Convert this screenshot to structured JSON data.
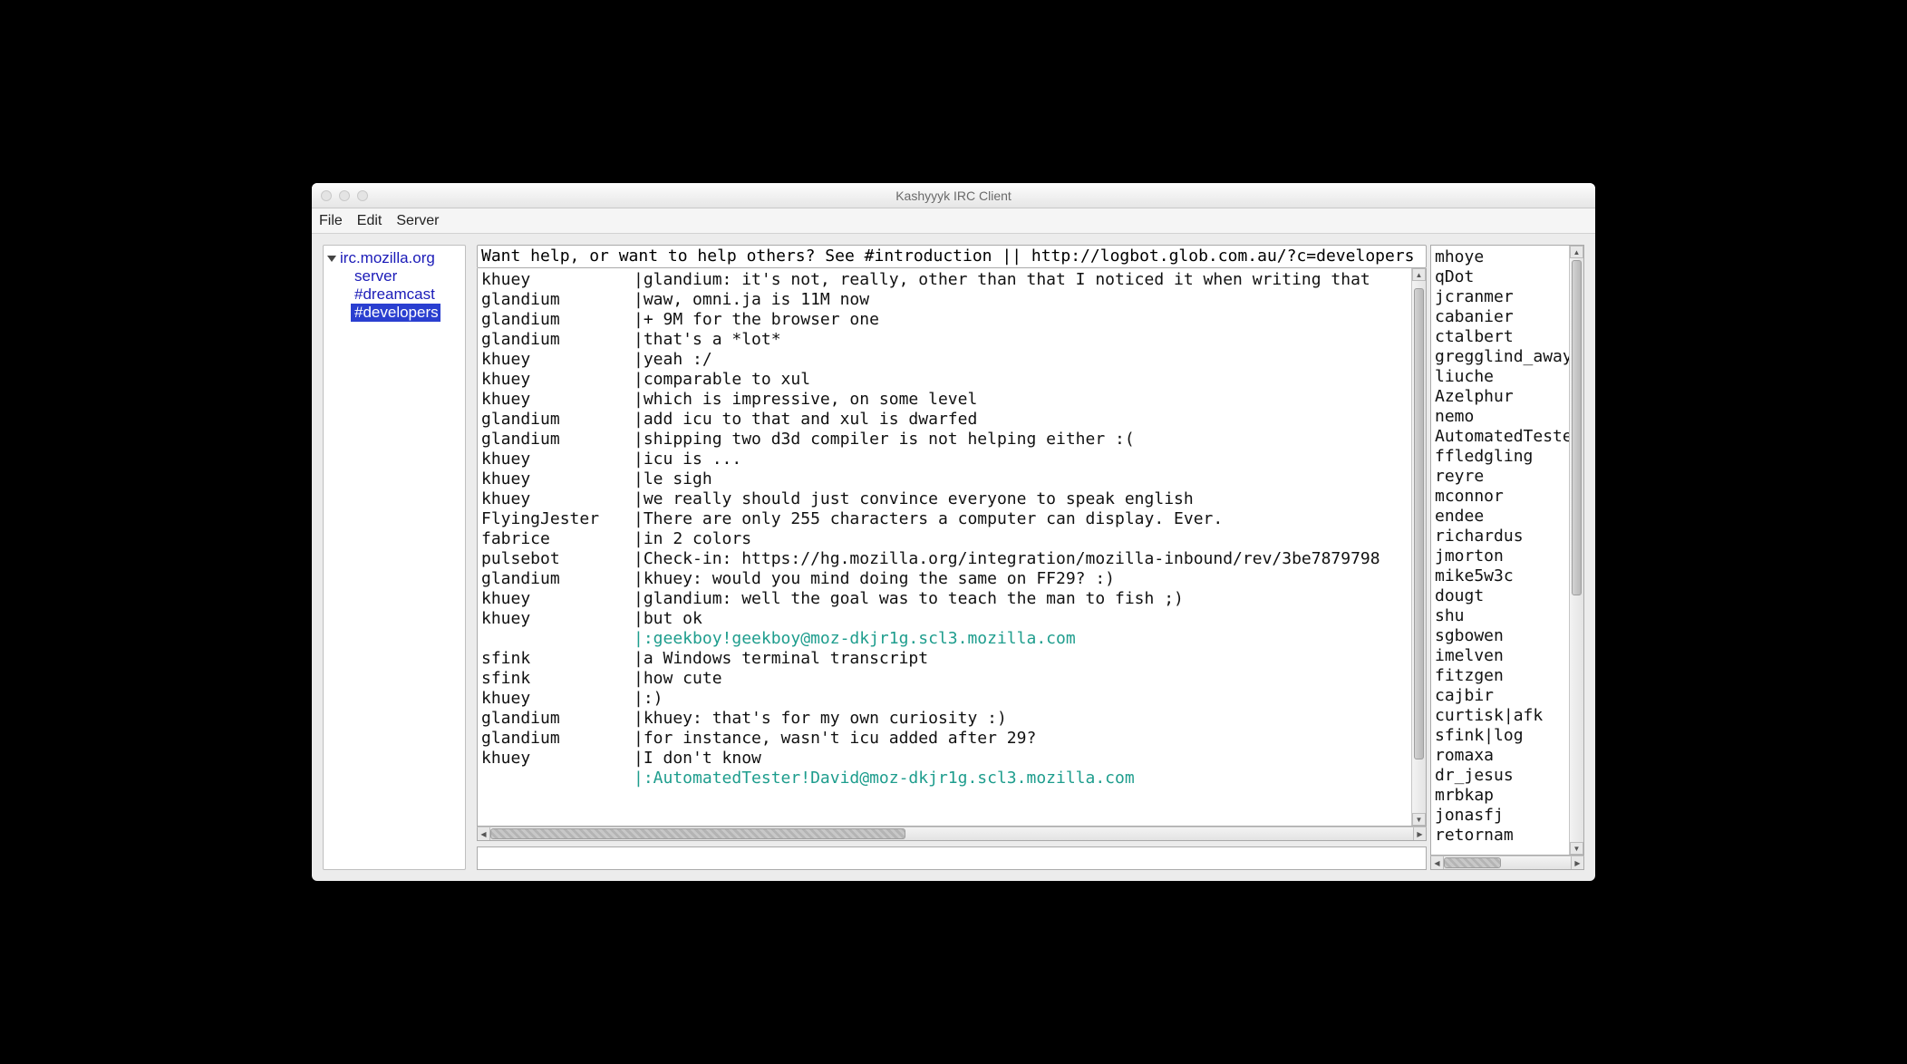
{
  "window": {
    "title": "Kashyyyk IRC Client"
  },
  "menubar": {
    "file": "File",
    "edit": "Edit",
    "server": "Server"
  },
  "sidebar": {
    "server": "irc.mozilla.org",
    "channels": [
      {
        "label": "server",
        "selected": false
      },
      {
        "label": "#dreamcast",
        "selected": false
      },
      {
        "label": "#developers",
        "selected": true
      }
    ]
  },
  "topic": "Want help, or want to help others? See #introduction || http://logbot.glob.com.au/?c=developers || Updated XCode? Acce",
  "chat": [
    {
      "nick": "khuey",
      "text": "|glandium: it's not, really, other than that I noticed it when writing that"
    },
    {
      "nick": "glandium",
      "text": "|waw, omni.ja is 11M now"
    },
    {
      "nick": "glandium",
      "text": "|+ 9M for the browser one"
    },
    {
      "nick": "glandium",
      "text": "|that's a *lot*"
    },
    {
      "nick": "khuey",
      "text": "|yeah :/"
    },
    {
      "nick": "khuey",
      "text": "|comparable to xul"
    },
    {
      "nick": "khuey",
      "text": "|which is impressive, on some level"
    },
    {
      "nick": "glandium",
      "text": "|add icu to that and xul is dwarfed"
    },
    {
      "nick": "glandium",
      "text": "|shipping two d3d compiler is not helping either :("
    },
    {
      "nick": "khuey",
      "text": "|icu is ..."
    },
    {
      "nick": "khuey",
      "text": "|le sigh"
    },
    {
      "nick": "khuey",
      "text": "|we really should just convince everyone to speak english"
    },
    {
      "nick": "FlyingJester",
      "text": "|There are only 255 characters a computer can display. Ever."
    },
    {
      "nick": "fabrice",
      "text": "|in 2 colors"
    },
    {
      "nick": "pulsebot",
      "text": "|Check-in: https://hg.mozilla.org/integration/mozilla-inbound/rev/3be7879798"
    },
    {
      "nick": "glandium",
      "text": "|khuey: would you mind doing the same on FF29? :)"
    },
    {
      "nick": "khuey",
      "text": "|glandium: well the goal was to teach the man to fish ;)"
    },
    {
      "nick": "khuey",
      "text": "|but ok"
    },
    {
      "nick": "",
      "text": "|:geekboy!geekboy@moz-dkjr1g.scl3.mozilla.com",
      "link": true
    },
    {
      "nick": "sfink",
      "text": "|a Windows terminal transcript"
    },
    {
      "nick": "sfink",
      "text": "|how cute"
    },
    {
      "nick": "khuey",
      "text": "|:)"
    },
    {
      "nick": "glandium",
      "text": "|khuey: that's for my own curiosity :)"
    },
    {
      "nick": "glandium",
      "text": "|for instance, wasn't icu added after 29?"
    },
    {
      "nick": "khuey",
      "text": "|I don't know"
    },
    {
      "nick": "",
      "text": "|:AutomatedTester!David@moz-dkjr1g.scl3.mozilla.com",
      "link": true
    }
  ],
  "users": [
    "mhoye",
    "qDot",
    "jcranmer",
    "cabanier",
    "ctalbert",
    "gregglind_away",
    "liuche",
    "Azelphur",
    "nemo",
    "AutomatedTester",
    "ffledgling",
    "reyre",
    "mconnor",
    "endee",
    "richardus",
    "jmorton",
    "mike5w3c",
    "dougt",
    "shu",
    "sgbowen",
    "imelven",
    "fitzgen",
    "cajbir",
    "curtisk|afk",
    "sfink|log",
    "romaxa",
    "dr_jesus",
    "mrbkap",
    "jonasfj",
    "retornam"
  ],
  "input": {
    "value": ""
  }
}
